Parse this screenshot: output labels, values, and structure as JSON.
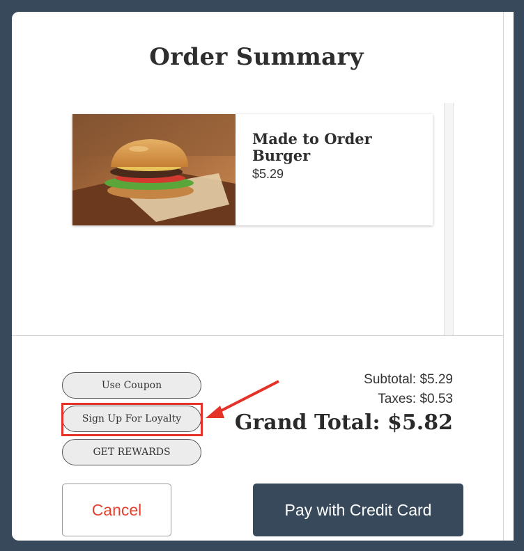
{
  "modal": {
    "title": "Order Summary"
  },
  "cart": {
    "items": [
      {
        "name": "Made to Order Burger",
        "price": "$5.29"
      }
    ]
  },
  "actions": {
    "coupon_label": "Use Coupon",
    "loyalty_label": "Sign Up For Loyalty",
    "rewards_label": "GET REWARDS"
  },
  "totals": {
    "subtotal": "Subtotal: $5.29",
    "taxes": "Taxes: $0.53",
    "grand_total": "Grand Total: $5.82"
  },
  "footer": {
    "cancel_label": "Cancel",
    "pay_label": "Pay with Credit Card"
  },
  "colors": {
    "brand_dark": "#37495a",
    "cancel_text": "#e2412f",
    "highlight": "#e53228"
  }
}
